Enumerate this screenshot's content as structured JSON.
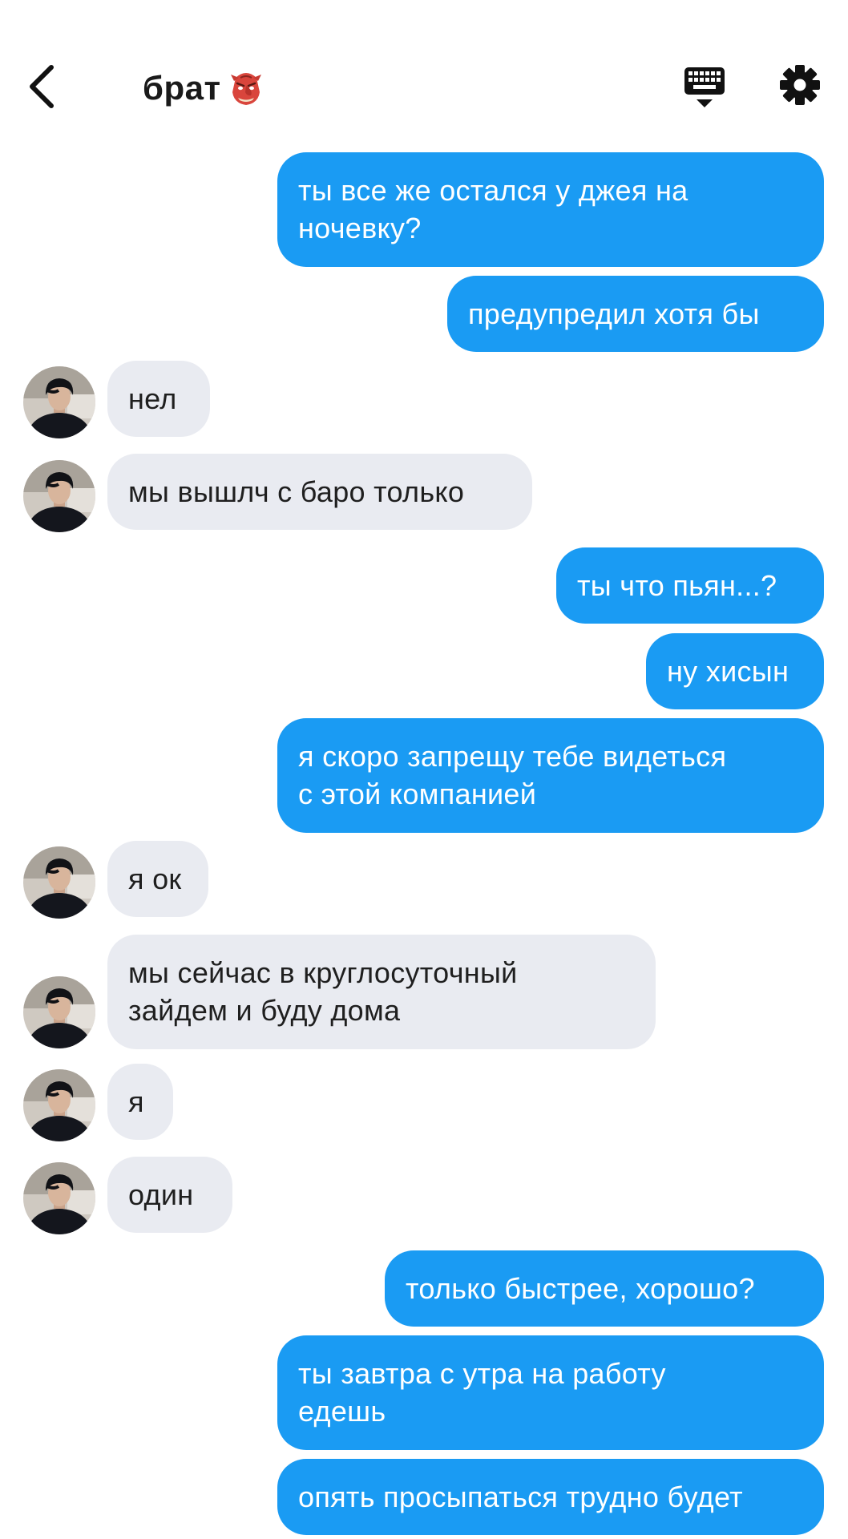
{
  "header": {
    "title": "брат",
    "emoji_icon": "goblin-mask-emoji",
    "back_icon": "chevron-left-icon",
    "keyboard_icon": "keyboard-icon",
    "settings_icon": "gear-icon"
  },
  "colors": {
    "outgoing_bubble": "#1a9bf3",
    "incoming_bubble": "#e9ebf1",
    "outgoing_text": "#ffffff",
    "incoming_text": "#1f1f1f"
  },
  "messages": [
    {
      "dir": "out",
      "text": "ты все же остался у джея на\nночевку?"
    },
    {
      "dir": "out",
      "text": "предупредил хотя бы"
    },
    {
      "dir": "in",
      "text": "нел"
    },
    {
      "dir": "in",
      "text": "мы вышлч с баро только"
    },
    {
      "dir": "out",
      "text": "ты что пьян...?"
    },
    {
      "dir": "out",
      "text": "ну хисын"
    },
    {
      "dir": "out",
      "text": "я скоро запрещу тебе видеться\nс этой компанией"
    },
    {
      "dir": "in",
      "text": "я ок"
    },
    {
      "dir": "in",
      "text": "мы сейчас в круглосуточный\nзайдем и буду дома"
    },
    {
      "dir": "in",
      "text": "я"
    },
    {
      "dir": "in",
      "text": "один"
    },
    {
      "dir": "out",
      "text": "только быстрее, хорошо?"
    },
    {
      "dir": "out",
      "text": "ты завтра с утра на работу\nедешь"
    },
    {
      "dir": "out",
      "text": "опять просыпаться трудно будет"
    }
  ]
}
